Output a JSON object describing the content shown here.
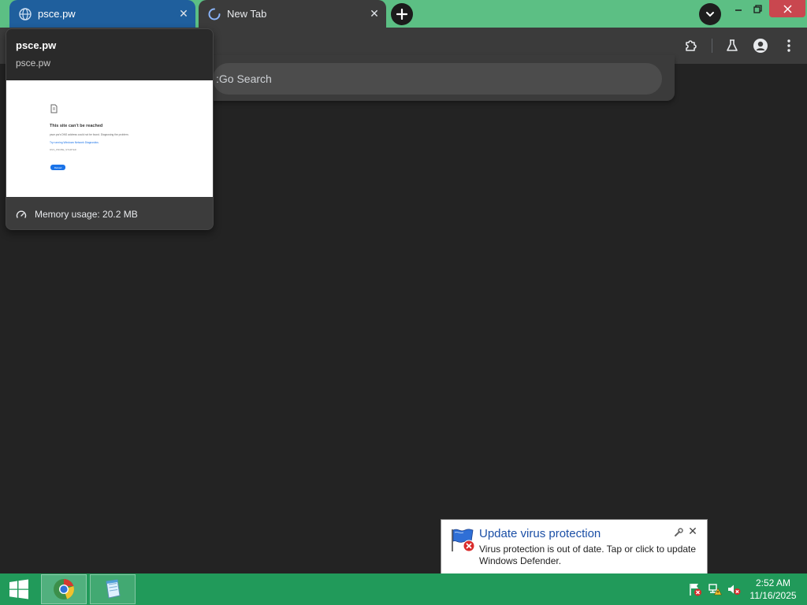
{
  "tabs": [
    {
      "title": "psce.pw",
      "close_glyph": "✕",
      "icon": "globe-icon",
      "active": true
    },
    {
      "title": "New Tab",
      "close_glyph": "✕",
      "icon": "loading-spinner-icon",
      "active": false
    }
  ],
  "omnibox": {
    "text": ":Go Search"
  },
  "hover_card": {
    "title": "psce.pw",
    "url": "psce.pw",
    "memory": "Memory usage: 20.2 MB",
    "preview": {
      "heading": "This site can’t be reached",
      "line1": "psce.pw's DNS address could not be found. Diagnosing the problem.",
      "line2": "Try running Windows Network Diagnostics.",
      "line3": "DNS_PROBE_STARTED",
      "button": "Reload"
    }
  },
  "balloon": {
    "title": "Update virus protection",
    "body": "Virus protection is out of date. Tap or click to update Windows Defender.",
    "close_glyph": "✕"
  },
  "clock": {
    "time": "2:52 AM",
    "date": "11/16/2025"
  },
  "colors": {
    "tabstrip": "#5cbf84",
    "active_tab": "#1f5f9d",
    "taskbar": "#219a5a",
    "window_close": "#c9474f",
    "balloon_title": "#1b4fa6"
  }
}
